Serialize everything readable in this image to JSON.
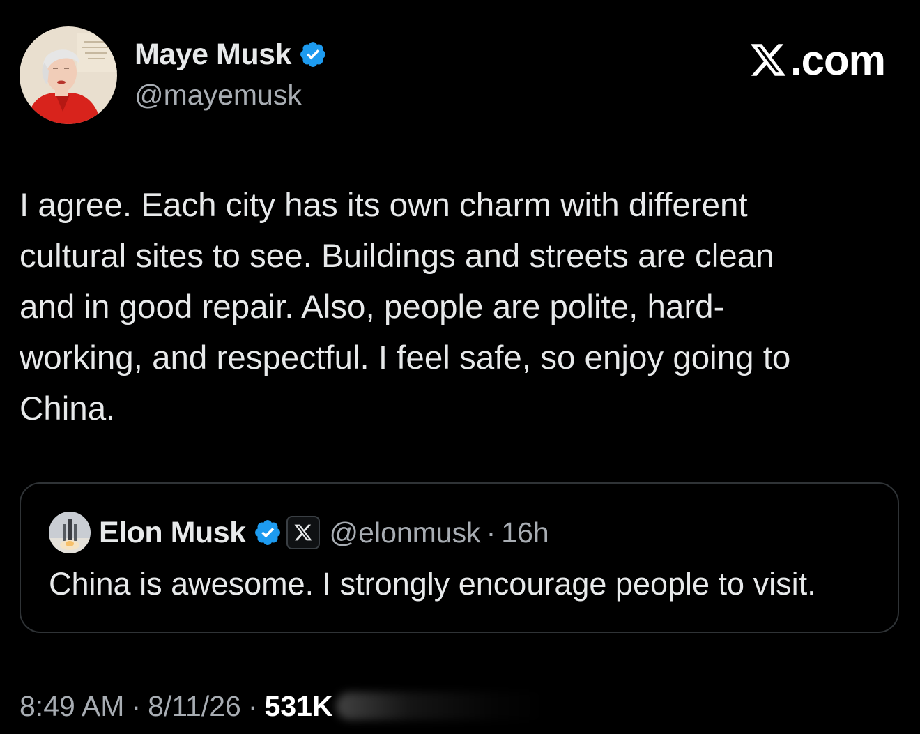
{
  "author": {
    "name": "Maye Musk",
    "handle": "@mayemusk",
    "verified": true,
    "avatar_icon": "portrait-avatar"
  },
  "brand": {
    "text": ".com",
    "icon": "x-logo-icon"
  },
  "tweet": {
    "text": "I agree. Each city has its own charm with different\ncultural sites to see. Buildings and streets are clean\nand in good repair. Also, people are polite, hard-\nworking, and respectful. I feel safe, so enjoy going to\nChina."
  },
  "quote": {
    "name": "Elon Musk",
    "handle": "@elonmusk",
    "separator": "·",
    "time": "16h",
    "verified": true,
    "affiliate_badge_icon": "x-logo-icon",
    "avatar_icon": "rocket-launch-avatar",
    "text": "China is awesome. I strongly encourage people to visit."
  },
  "meta": {
    "time": "8:49 AM",
    "separator": "·",
    "date": "8/11/26",
    "views": "531K"
  },
  "colors": {
    "background": "#000000",
    "primary_text": "#e7e9ea",
    "secondary_text": "#a8adb3",
    "verified_blue": "#1d9bf0",
    "card_border": "#2f3336"
  }
}
